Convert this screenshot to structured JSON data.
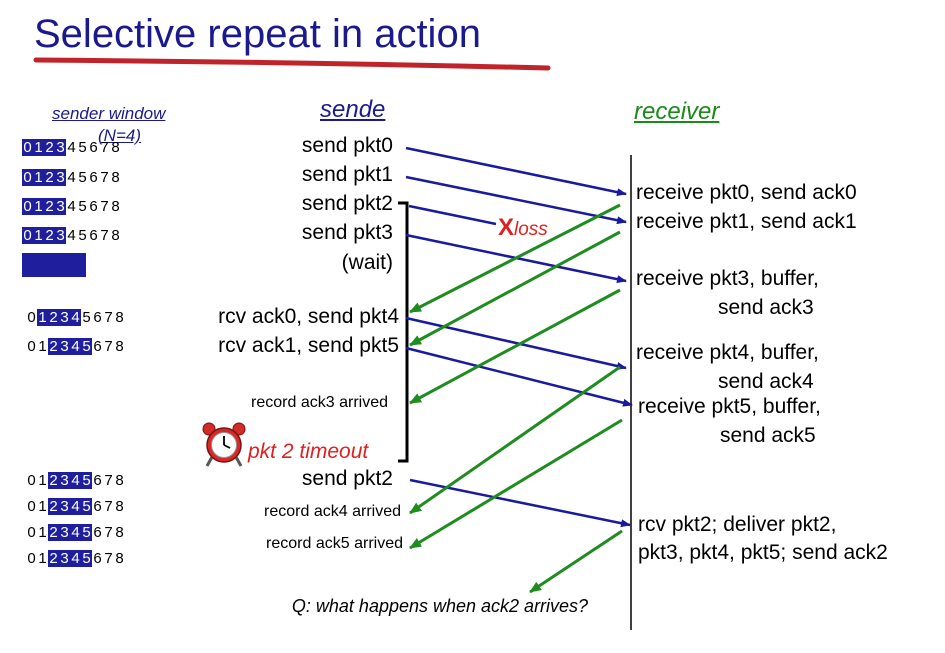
{
  "title": "Selective repeat in action",
  "colors": {
    "title": "#1a1a8c",
    "sender_arrow": "#1a1a9e",
    "receiver_arrow": "#1e8c1e",
    "loss": "#e02020",
    "window_fill": "#1f1f9e"
  },
  "headers": {
    "sender": "sende",
    "receiver": "receiver",
    "window_label": "sender window",
    "window_size": "(N=4)"
  },
  "windows": [
    {
      "digits": [
        "0",
        "1",
        "2",
        "3",
        "4",
        "5",
        "6",
        "7",
        "8"
      ],
      "highlight_start": 0
    },
    {
      "digits": [
        "0",
        "1",
        "2",
        "3",
        "4",
        "5",
        "6",
        "7",
        "8"
      ],
      "highlight_start": 0
    },
    {
      "digits": [
        "0",
        "1",
        "2",
        "3",
        "4",
        "5",
        "6",
        "7",
        "8"
      ],
      "highlight_start": 0
    },
    {
      "digits": [
        "0",
        "1",
        "2",
        "3",
        "4",
        "5",
        "6",
        "7",
        "8"
      ],
      "highlight_start": 0
    },
    {
      "digits": [
        "0",
        "1",
        "2",
        "3",
        "4",
        "5",
        "6",
        "7",
        "8"
      ],
      "highlight_start": 1
    },
    {
      "digits": [
        "0",
        "1",
        "2",
        "3",
        "4",
        "5",
        "6",
        "7",
        "8"
      ],
      "highlight_start": 2
    },
    {
      "digits": [
        "0",
        "1",
        "2",
        "3",
        "4",
        "5",
        "6",
        "7",
        "8"
      ],
      "highlight_start": 2
    },
    {
      "digits": [
        "0",
        "1",
        "2",
        "3",
        "4",
        "5",
        "6",
        "7",
        "8"
      ],
      "highlight_start": 2
    },
    {
      "digits": [
        "0",
        "1",
        "2",
        "3",
        "4",
        "5",
        "6",
        "7",
        "8"
      ],
      "highlight_start": 2
    },
    {
      "digits": [
        "0",
        "1",
        "2",
        "3",
        "4",
        "5",
        "6",
        "7",
        "8"
      ],
      "highlight_start": 2
    }
  ],
  "sender_events": {
    "send_pkt0": "send  pkt0",
    "send_pkt1": "send  pkt1",
    "send_pkt2": "send  pkt2",
    "send_pkt3": "send  pkt3",
    "wait": "(wait)",
    "rcv_ack0": "rcv ack0, send pkt4",
    "rcv_ack1": "rcv ack1, send pkt5",
    "record_ack3": "record ack3 arrived",
    "timeout": "pkt 2 timeout",
    "resend_pkt2": "send  pkt2",
    "record_ack4": "record ack4 arrived",
    "record_ack5": "record ack5 arrived"
  },
  "loss": {
    "mark": "X",
    "label": "loss"
  },
  "receiver_events": {
    "r0": "receive pkt0, send ack0",
    "r1": "receive pkt1, send ack1",
    "r3a": "receive pkt3, buffer,",
    "r3b": "send ack3",
    "r4a": "receive pkt4, buffer,",
    "r4b": "send ack4",
    "r5a": "receive pkt5, buffer,",
    "r5b": "send ack5",
    "r2a": "rcv pkt2; deliver pkt2,",
    "r2b": "pkt3, pkt4, pkt5; send ack2"
  },
  "question": "Q: what happens when ack2 arrives?"
}
